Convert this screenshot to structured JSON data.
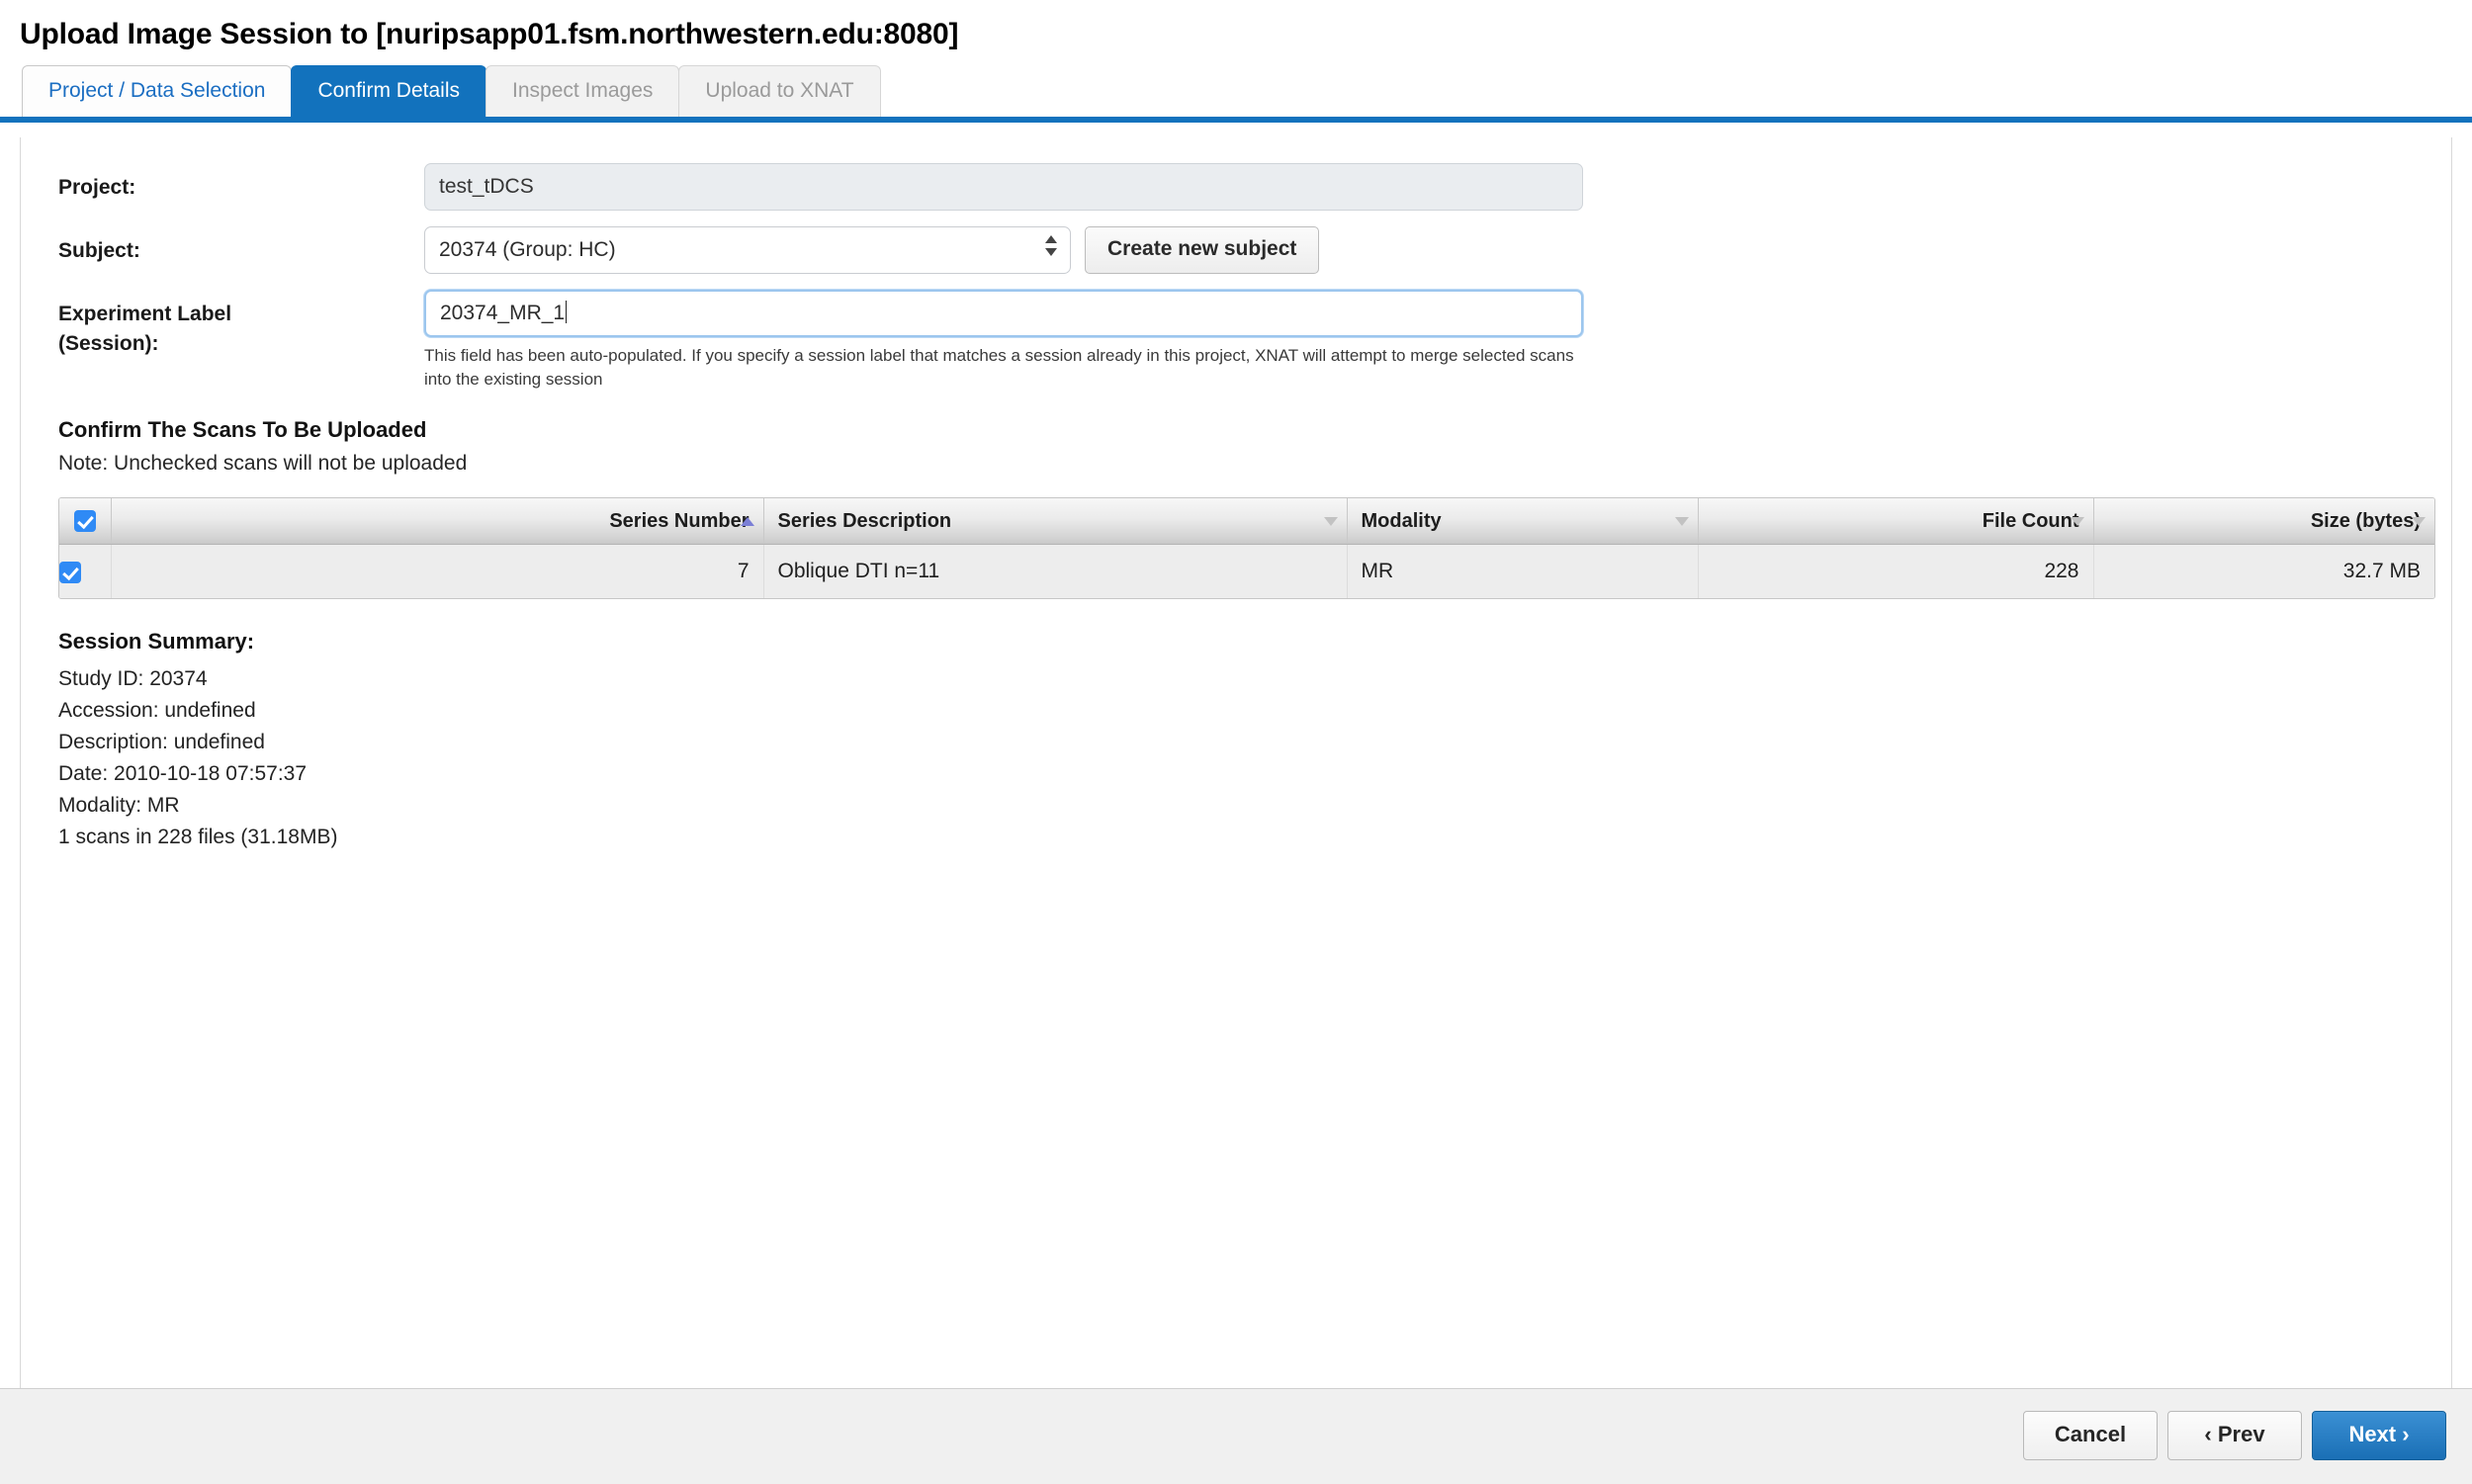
{
  "window": {
    "title": "Upload Image Session to [nuripsapp01.fsm.northwestern.edu:8080]"
  },
  "tabs": [
    {
      "label": "Project / Data Selection",
      "state": "enabled"
    },
    {
      "label": "Confirm Details",
      "state": "active"
    },
    {
      "label": "Inspect Images",
      "state": "disabled"
    },
    {
      "label": "Upload to XNAT",
      "state": "disabled"
    }
  ],
  "form": {
    "project": {
      "label": "Project:",
      "value": "test_tDCS",
      "readonly": true
    },
    "subject": {
      "label": "Subject:",
      "value": "20374 (Group: HC)",
      "create_button": "Create new subject"
    },
    "experiment": {
      "label_line1": "Experiment Label",
      "label_line2": "(Session):",
      "value": "20374_MR_1",
      "help": "This field has been auto-populated. If you specify a session label that matches a session already in this project, XNAT will attempt to merge selected scans into the existing session"
    }
  },
  "scans_section": {
    "heading": "Confirm The Scans To Be Uploaded",
    "note": "Note: Unchecked scans will not be uploaded",
    "select_all_checked": true,
    "columns": [
      {
        "label": "Series Number",
        "align": "right",
        "sort": "asc"
      },
      {
        "label": "Series Description",
        "align": "left",
        "sort": "none"
      },
      {
        "label": "Modality",
        "align": "left",
        "sort": "none"
      },
      {
        "label": "File Count",
        "align": "right",
        "sort": "none"
      },
      {
        "label": "Size (bytes)",
        "align": "right",
        "sort": "none"
      }
    ],
    "rows": [
      {
        "checked": true,
        "series_number": "7",
        "series_description": "Oblique DTI n=11",
        "modality": "MR",
        "file_count": "228",
        "size": "32.7 MB"
      }
    ]
  },
  "summary": {
    "heading": "Session Summary:",
    "lines": [
      "Study ID: 20374",
      "Accession: undefined",
      "Description: undefined",
      "Date: 2010-10-18 07:57:37",
      "Modality: MR",
      "1 scans in 228 files (31.18MB)"
    ]
  },
  "footer": {
    "cancel": "Cancel",
    "prev": "‹ Prev",
    "next": "Next ›"
  },
  "colors": {
    "accent_blue": "#1272bd",
    "active_tab_text": "#ffffff",
    "link_blue": "#1b6ec2",
    "checkbox_blue": "#2f8af5",
    "sort_active": "#7b7fd6",
    "focus_border": "#9cc6ee"
  }
}
